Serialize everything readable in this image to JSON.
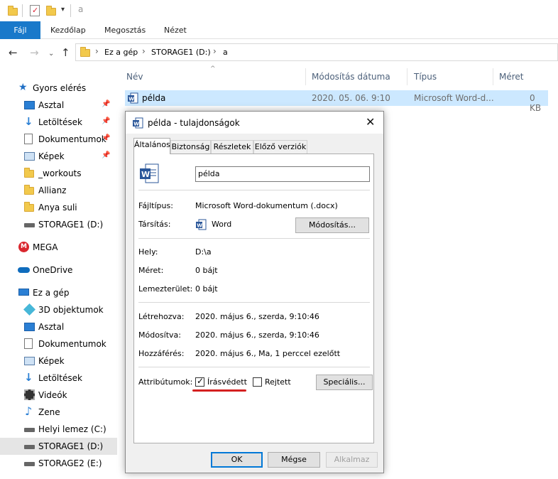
{
  "window": {
    "title": "a"
  },
  "ribbon": {
    "tabs": [
      "Fájl",
      "Kezdőlap",
      "Megosztás",
      "Nézet"
    ]
  },
  "address": {
    "crumbs": [
      "Ez a gép",
      "STORAGE1 (D:)",
      "a"
    ]
  },
  "sidebar": {
    "quick_access": "Gyors elérés",
    "quick_items": [
      "Asztal",
      "Letöltések",
      "Dokumentumok",
      "Képek",
      "_workouts",
      "Allianz",
      "Anya suli",
      "STORAGE1 (D:)"
    ],
    "mega": "MEGA",
    "onedrive": "OneDrive",
    "this_pc": "Ez a gép",
    "pc_items": [
      "3D objektumok",
      "Asztal",
      "Dokumentumok",
      "Képek",
      "Letöltések",
      "Videók",
      "Zene",
      "Helyi lemez (C:)",
      "STORAGE1 (D:)",
      "STORAGE2 (E:)"
    ]
  },
  "filelist": {
    "columns": [
      "Név",
      "Módosítás dátuma",
      "Típus",
      "Méret"
    ],
    "rows": [
      {
        "name": "példa",
        "date": "2020. 05. 06. 9:10",
        "type": "Microsoft Word-d...",
        "size": "0 KB"
      }
    ]
  },
  "dialog": {
    "title": "példa - tulajdonságok",
    "tabs": [
      "Általános",
      "Biztonság",
      "Részletek",
      "Előző verziók"
    ],
    "filename": "példa",
    "filetype_label": "Fájltípus:",
    "filetype_value": "Microsoft Word-dokumentum (.docx)",
    "assoc_label": "Társítás:",
    "assoc_value": "Word",
    "change_button": "Módosítás...",
    "location_label": "Hely:",
    "location_value": "D:\\a",
    "size_label": "Méret:",
    "size_value": "0 bájt",
    "disk_label": "Lemezterület:",
    "disk_value": "0 bájt",
    "created_label": "Létrehozva:",
    "created_value": "2020. május 6., szerda, 9:10:46",
    "modified_label": "Módosítva:",
    "modified_value": "2020. május 6., szerda, 9:10:46",
    "accessed_label": "Hozzáférés:",
    "accessed_value": "2020. május 6., Ma, 1 perccel ezelőtt",
    "attributes_label": "Attribútumok:",
    "readonly_label": "Írásvédett",
    "readonly_checked": true,
    "hidden_label": "Rejtett",
    "hidden_checked": false,
    "advanced_button": "Speciális...",
    "ok_button": "OK",
    "cancel_button": "Mégse",
    "apply_button": "Alkalmaz"
  },
  "colors": {
    "accent": "#1979ca",
    "selection": "#cce8ff",
    "annotation": "#d42020"
  }
}
